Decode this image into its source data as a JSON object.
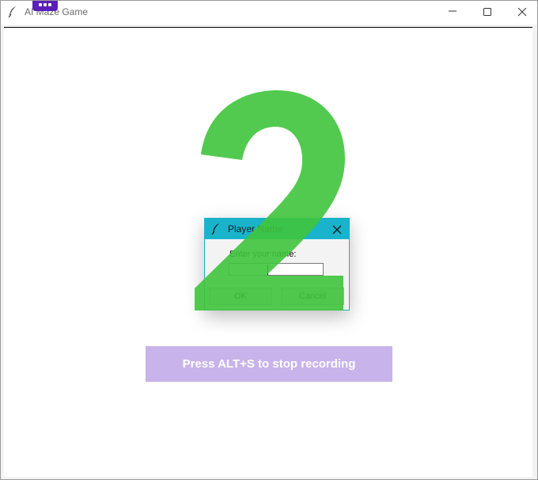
{
  "window": {
    "title": "AI Maze Game"
  },
  "dialog": {
    "title": "Player Name",
    "prompt": "Enter your name:",
    "input_value": "",
    "ok_label": "OK",
    "cancel_label": "Cancel"
  },
  "countdown": {
    "digit": "2",
    "color": "#3fc43c"
  },
  "recording": {
    "message": "Press ALT+S to stop recording",
    "color": "#c9b3eb"
  },
  "colors": {
    "dialog_titlebar": "#19b4cc",
    "overlay_badge": "#5a1fb8"
  },
  "icons": {
    "window": "feather-icon",
    "minimize": "minimize-icon",
    "maximize": "maximize-icon",
    "close": "close-icon"
  }
}
